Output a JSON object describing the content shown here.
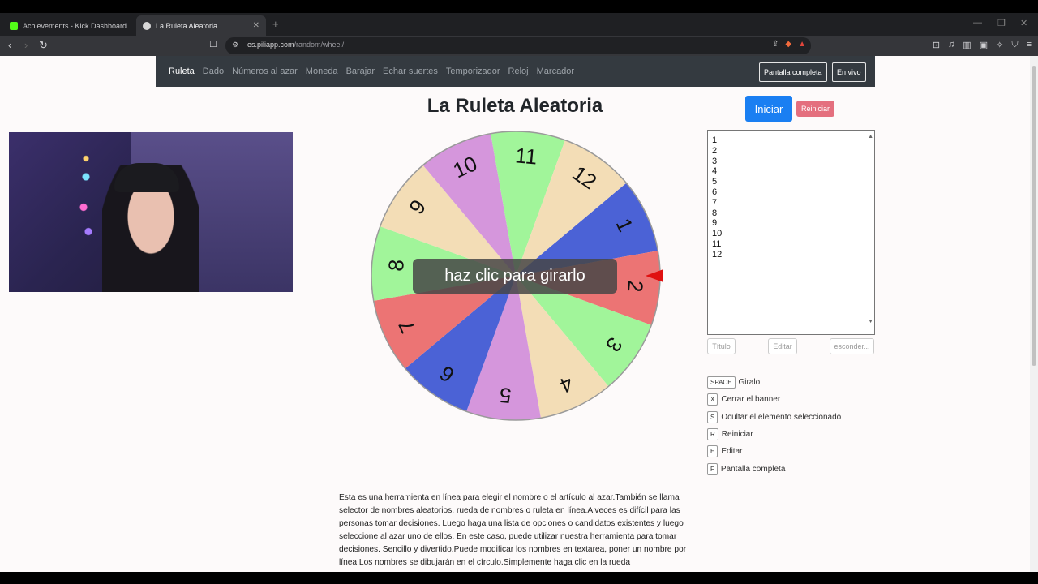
{
  "browser": {
    "tabs": [
      {
        "title": "Achievements - Kick Dashboard",
        "active": false,
        "favicon_color": "#53fc18"
      },
      {
        "title": "La Ruleta Aleatoria",
        "active": true,
        "favicon_color": "#d8d8d8"
      }
    ],
    "url_domain": "es.piliapp.com",
    "url_path": "/random/wheel/"
  },
  "site_nav": {
    "links": [
      "Ruleta",
      "Dado",
      "Números al azar",
      "Moneda",
      "Barajar",
      "Echar suertes",
      "Temporizador",
      "Reloj",
      "Marcador"
    ],
    "fullscreen_label": "Pantalla completa",
    "live_label": "En vivo"
  },
  "heading": "La Ruleta Aleatoria",
  "buttons": {
    "start": "Iniciar",
    "reset": "Reiniciar",
    "title": "Título",
    "edit": "Editar",
    "hide": "esconder..."
  },
  "wheel": {
    "banner": "haz clic para girarlo",
    "segments": [
      {
        "label": "1",
        "color": "#4b62d6"
      },
      {
        "label": "2",
        "color": "#ec7474"
      },
      {
        "label": "3",
        "color": "#a1f59a"
      },
      {
        "label": "4",
        "color": "#f3ddb6"
      },
      {
        "label": "5",
        "color": "#d596dc"
      },
      {
        "label": "6",
        "color": "#4b62d6"
      },
      {
        "label": "7",
        "color": "#ec7474"
      },
      {
        "label": "8",
        "color": "#a1f59a"
      },
      {
        "label": "9",
        "color": "#f3ddb6"
      },
      {
        "label": "10",
        "color": "#d596dc"
      },
      {
        "label": "11",
        "color": "#a1f59a"
      },
      {
        "label": "12",
        "color": "#f3ddb6"
      }
    ],
    "pointer_color": "#e01010"
  },
  "textarea_value": "1\n2\n3\n4\n5\n6\n7\n8\n9\n10\n11\n12",
  "shortcuts": [
    {
      "key": "SPACE",
      "label": "Giralo"
    },
    {
      "key": "X",
      "label": "Cerrar el banner"
    },
    {
      "key": "S",
      "label": "Ocultar el elemento seleccionado"
    },
    {
      "key": "R",
      "label": "Reiniciar"
    },
    {
      "key": "E",
      "label": "Editar"
    },
    {
      "key": "F",
      "label": "Pantalla completa"
    }
  ],
  "description": "Esta es una herramienta en línea para elegir el nombre o el artículo al azar.También se llama selector de nombres aleatorios, rueda de nombres o ruleta en línea.A veces es difícil para las personas tomar decisiones. Luego haga una lista de opciones o candidatos existentes y luego seleccione al azar uno de ellos. En este caso, puede utilizar nuestra herramienta para tomar decisiones. Sencillo y divertido.Puede modificar los nombres en textarea, poner un nombre por línea.Los nombres se dibujarán en el círculo.Simplemente haga clic en la rueda"
}
